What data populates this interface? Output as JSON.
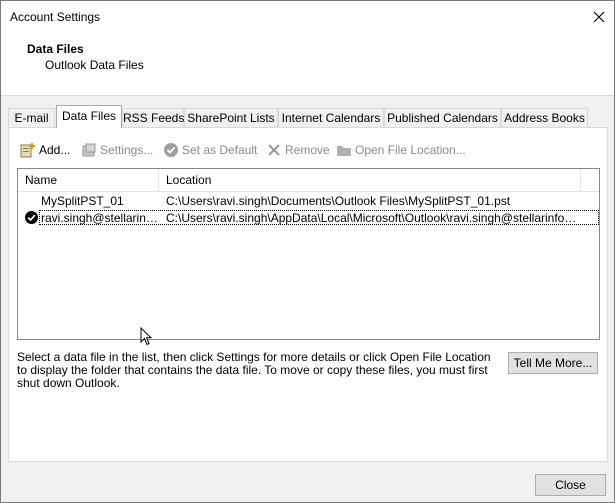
{
  "window": {
    "title": "Account Settings"
  },
  "header": {
    "title": "Data Files",
    "subtitle": "Outlook Data Files"
  },
  "tabs": [
    {
      "label": "E-mail"
    },
    {
      "label": "Data Files"
    },
    {
      "label": "RSS Feeds"
    },
    {
      "label": "SharePoint Lists"
    },
    {
      "label": "Internet Calendars"
    },
    {
      "label": "Published Calendars"
    },
    {
      "label": "Address Books"
    }
  ],
  "toolbar": {
    "add": "Add...",
    "settings": "Settings...",
    "set_default": "Set as Default",
    "remove": "Remove",
    "open_location": "Open File Location..."
  },
  "list": {
    "columns": {
      "name": "Name",
      "location": "Location"
    },
    "rows": [
      {
        "name": "MySplitPST_01",
        "location": "C:\\Users\\ravi.singh\\Documents\\Outlook Files\\MySplitPST_01.pst",
        "default": false
      },
      {
        "name": "ravi.singh@stellarinf...",
        "location": "C:\\Users\\ravi.singh\\AppData\\Local\\Microsoft\\Outlook\\ravi.singh@stellarinfo.c...",
        "default": true
      }
    ]
  },
  "description": "Select a data file in the list, then click Settings for more details or click Open File Location to display the folder that contains the data file. To move or copy these files, you must first shut down Outlook.",
  "buttons": {
    "tell_me_more": "Tell Me More...",
    "close": "Close"
  },
  "colors": {
    "disabled_text": "#8a8a8a",
    "header_bg": "#ffffff",
    "dialog_bg": "#f0f0f0"
  }
}
